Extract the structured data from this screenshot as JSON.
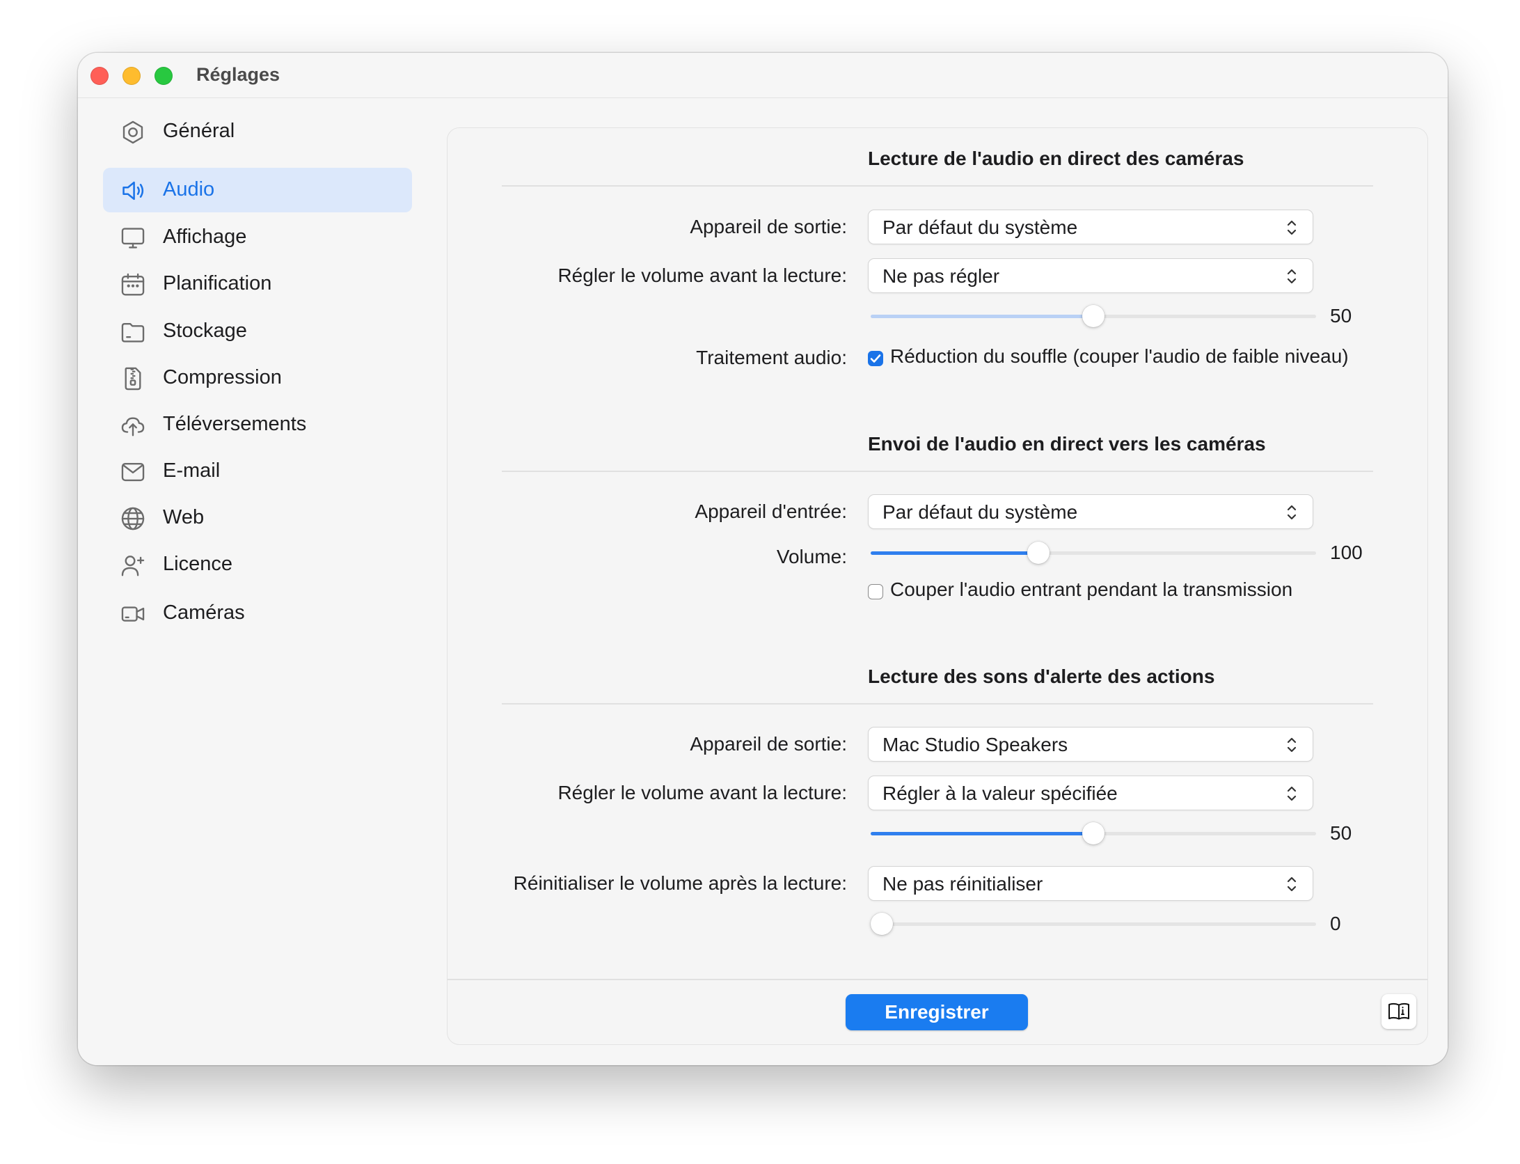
{
  "window": {
    "title": "Réglages"
  },
  "sidebar": {
    "items": [
      {
        "label": "Général",
        "icon": "gear-icon"
      },
      {
        "label": "Audio",
        "icon": "speaker-icon",
        "selected": true
      },
      {
        "label": "Affichage",
        "icon": "display-icon"
      },
      {
        "label": "Planification",
        "icon": "calendar-icon"
      },
      {
        "label": "Stockage",
        "icon": "folder-icon"
      },
      {
        "label": "Compression",
        "icon": "zipper-icon"
      },
      {
        "label": "Téléversements",
        "icon": "cloud-upload-icon"
      },
      {
        "label": "E-mail",
        "icon": "envelope-icon"
      },
      {
        "label": "Web",
        "icon": "globe-icon"
      },
      {
        "label": "Licence",
        "icon": "person-add-icon"
      },
      {
        "label": "Caméras",
        "icon": "video-camera-icon"
      }
    ]
  },
  "sections": {
    "camera_playback": {
      "title": "Lecture de l'audio en direct des caméras",
      "output_label": "Appareil de sortie:",
      "output_value": "Par défaut du système",
      "volume_adjust_label": "Régler le volume avant la lecture:",
      "volume_adjust_value": "Ne pas régler",
      "volume_slider": 50,
      "volume_slider_text": "50",
      "processing_label": "Traitement audio:",
      "noise_reduction_label": "Réduction du souffle (couper l'audio de faible niveau)",
      "noise_reduction_checked": true
    },
    "camera_send": {
      "title": "Envoi de l'audio en direct vers les caméras",
      "input_label": "Appareil d'entrée:",
      "input_value": "Par défaut du système",
      "volume_label": "Volume:",
      "volume_slider": 100,
      "volume_slider_text": "100",
      "mute_incoming_label": "Couper l'audio entrant pendant la transmission",
      "mute_incoming_checked": false
    },
    "alert_sounds": {
      "title": "Lecture des sons d'alerte des actions",
      "output_label": "Appareil de sortie:",
      "output_value": "Mac Studio Speakers",
      "volume_adjust_label": "Régler le volume avant la lecture:",
      "volume_adjust_value": "Régler à la valeur spécifiée",
      "volume_slider": 50,
      "volume_slider_text": "50",
      "reset_label": "Réinitialiser le volume après la lecture:",
      "reset_value": "Ne pas réinitialiser",
      "reset_slider": 0,
      "reset_slider_text": "0"
    }
  },
  "footer": {
    "save_label": "Enregistrer",
    "help_icon": "manual-icon"
  },
  "colors": {
    "accent": "#1a73e8",
    "selection_bg": "#dce8fb",
    "button": "#1a7cf0"
  }
}
